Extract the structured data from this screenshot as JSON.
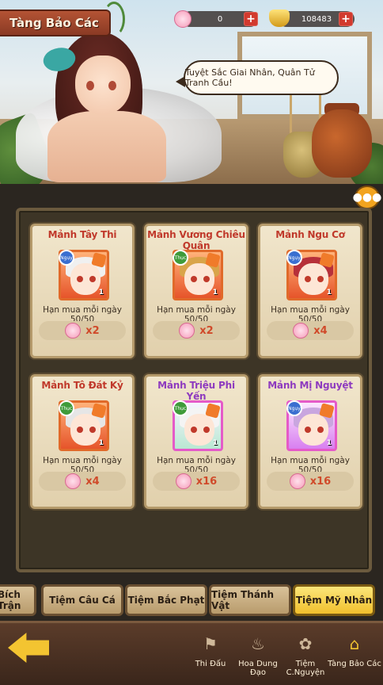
{
  "header": {
    "title": "Tàng Bảo Các",
    "currency_blossom": "0",
    "currency_gold": "108483",
    "plus_label": "+"
  },
  "banner": {
    "speech": "Tuyệt Sắc Giai Nhân, Quân Tử Tranh Cầu!"
  },
  "items": [
    {
      "name": "Mảnh Tây Thi",
      "name_color": "#c0392b",
      "tag": "Ngụy",
      "count": "1",
      "limit": "Hạn mua mỗi ngày 50/50",
      "price": "x2",
      "frame": "orange"
    },
    {
      "name": "Mảnh Vương Chiêu Quân",
      "name_color": "#c0392b",
      "tag": "Thục",
      "count": "1",
      "limit": "Hạn mua mỗi ngày 50/50",
      "price": "x2",
      "frame": "orange"
    },
    {
      "name": "Mảnh Ngu Cơ",
      "name_color": "#c0392b",
      "tag": "Ngụy",
      "count": "1",
      "limit": "Hạn mua mỗi ngày 50/50",
      "price": "x4",
      "frame": "orange"
    },
    {
      "name": "Mảnh Tô Đát Kỷ",
      "name_color": "#c0392b",
      "tag": "Thục",
      "count": "1",
      "limit": "Hạn mua mỗi ngày 50/50",
      "price": "x4",
      "frame": "orange"
    },
    {
      "name": "Mảnh Triệu Phi Yến",
      "name_color": "#8e3bbf",
      "tag": "Thục",
      "count": "1",
      "limit": "Hạn mua mỗi ngày 50/50",
      "price": "x16",
      "frame": "green"
    },
    {
      "name": "Mảnh Mị Nguyệt",
      "name_color": "#8e3bbf",
      "tag": "Ngụy",
      "count": "1",
      "limit": "Hạn mua mỗi ngày 50/50",
      "price": "x16",
      "frame": "purple"
    }
  ],
  "tabs": [
    {
      "label": "Bích Trận",
      "active": false
    },
    {
      "label": "Tiệm Câu Cá",
      "active": false
    },
    {
      "label": "Tiệm Bắc Phạt",
      "active": false
    },
    {
      "label": "Tiệm Thánh Vật",
      "active": false
    },
    {
      "label": "Tiệm Mỹ Nhân",
      "active": true
    }
  ],
  "nav": [
    {
      "label": "Thi Đấu",
      "icon": "banner-icon"
    },
    {
      "label": "Hoa Dung Đạo",
      "icon": "flame-icon"
    },
    {
      "label": "Tiệm C.Nguyện",
      "icon": "lotus-icon"
    },
    {
      "label": "Tàng Bảo Các",
      "icon": "pagoda-icon"
    }
  ],
  "colors": {
    "accent": "#f3c431",
    "title_bg": "#a8472c",
    "plus_red": "#d23a2e"
  }
}
